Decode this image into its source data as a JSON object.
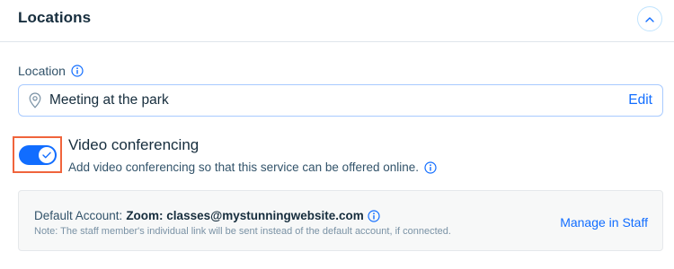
{
  "header": {
    "title": "Locations",
    "collapse_icon": "chevron-up-icon"
  },
  "location": {
    "label": "Location",
    "label_info_icon": "info-icon",
    "pin_icon": "location-pin-icon",
    "value": "Meeting at the park",
    "edit_label": "Edit"
  },
  "video_conferencing": {
    "title": "Video conferencing",
    "enabled": true,
    "description": "Add video conferencing so that this service can be offered online.",
    "info_icon": "info-icon"
  },
  "default_account": {
    "prefix": "Default Account:",
    "value": "Zoom: classes@mystunningwebsite.com",
    "info_icon": "info-icon",
    "note": "Note: The staff member's individual link will be sent instead of the default account, if connected.",
    "manage_label": "Manage in Staff"
  },
  "colors": {
    "accent": "#116dff",
    "highlight_border": "#f0643c",
    "title_text": "#162d3d",
    "secondary_text": "#32536a",
    "panel_background": "#f7f8f8"
  }
}
